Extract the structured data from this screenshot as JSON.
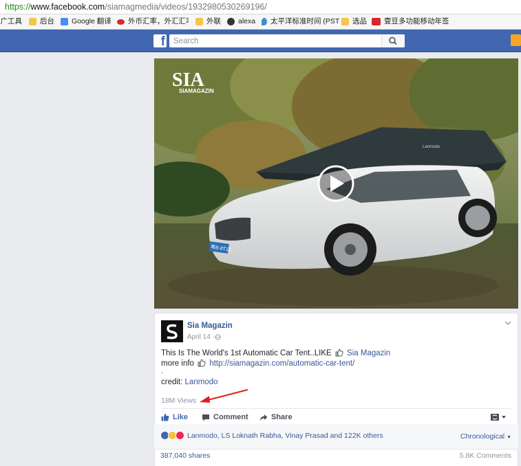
{
  "browser": {
    "url_scheme": "https://",
    "url_host": "www.facebook.com",
    "url_path": "/siamagmedia/videos/1932980530269196/",
    "bookmarks": [
      {
        "label": "推广工具",
        "icon": "blank",
        "color": "#f6f6f6"
      },
      {
        "label": "后台",
        "icon": "folder-icon",
        "color": "#f3c64a"
      },
      {
        "label": "Google 翻译",
        "icon": "translate-icon",
        "color": "#4c8bf5"
      },
      {
        "label": "外币汇率，外汇汇率",
        "icon": "currency-icon",
        "color": "#d8282a"
      },
      {
        "label": "外联",
        "icon": "folder-icon",
        "color": "#f3c64a"
      },
      {
        "label": "alexa",
        "icon": "alexa-icon",
        "color": "#333333"
      },
      {
        "label": "太平洋标准时间 (PST",
        "icon": "location-pin-icon",
        "color": "#3c8dd8"
      },
      {
        "label": "选品",
        "icon": "folder-icon",
        "color": "#f3c64a"
      },
      {
        "label": "壹豆多功能移动年签",
        "icon": "jd-icon",
        "color": "#d8282a"
      }
    ]
  },
  "facebook": {
    "brand_color": "#4267b2",
    "search_placeholder": "Search"
  },
  "video": {
    "watermark_logo": "SIA",
    "watermark_text": "SIAMAGAZIN",
    "canopy_text": "Lanmodo",
    "plate": "粤B·8T12"
  },
  "post": {
    "page_name": "Sia Magazin",
    "date": "April 14 ·",
    "line1_text": "This Is The World's 1st Automatic Car Tent..LIKE",
    "line1_link": "Sia Magazin",
    "line2_text": "more info",
    "line2_link": "http://siamagazin.com/automatic-car-tent/",
    "dot": ".",
    "credit_label": "credit:",
    "credit_link": "Lanmodo",
    "views": "18M Views",
    "like": "Like",
    "comment": "Comment",
    "share": "Share",
    "reactions_text": "Lanmodo, LS Loknath Rabha, Vinay Prasad and 122K others",
    "order": "Chronological",
    "shares_count": "387,040 shares",
    "comments_count": "5.8K Comments"
  },
  "annotation": {
    "arrow_color": "#e02020"
  }
}
